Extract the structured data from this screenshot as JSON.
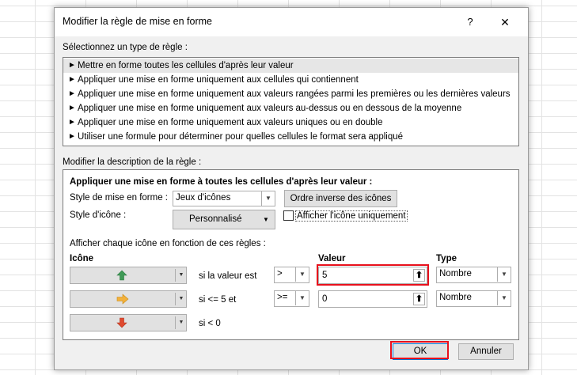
{
  "dialog": {
    "title": "Modifier la règle de mise en forme",
    "help": "?",
    "close": "✕"
  },
  "rule_type": {
    "label": "Sélectionnez un type de règle :",
    "items": [
      {
        "label": "Mettre en forme toutes les cellules d'après leur valeur",
        "selected": true
      },
      {
        "label": "Appliquer une mise en forme uniquement aux cellules qui contiennent",
        "selected": false
      },
      {
        "label": "Appliquer une mise en forme uniquement aux valeurs rangées parmi les premières ou les dernières valeurs",
        "selected": false
      },
      {
        "label": "Appliquer une mise en forme uniquement aux valeurs au-dessus ou en dessous de la moyenne",
        "selected": false
      },
      {
        "label": "Appliquer une mise en forme uniquement aux valeurs uniques ou en double",
        "selected": false
      },
      {
        "label": "Utiliser une formule pour déterminer pour quelles cellules le format sera appliqué",
        "selected": false
      }
    ]
  },
  "description": {
    "label": "Modifier la description de la règle :",
    "heading": "Appliquer une mise en forme à toutes les cellules d'après leur valeur :",
    "format_style_label": "Style de mise en forme :",
    "format_style_value": "Jeux d'icônes",
    "reverse_button": "Ordre inverse des icônes",
    "icon_style_label": "Style d'icône :",
    "icon_style_value": "Personnalisé",
    "show_icon_only_label": "Afficher l'icône uniquement",
    "show_icon_only_checked": false,
    "rules_caption": "Afficher chaque icône en fonction de ces règles :",
    "col_icon": "Icône",
    "col_value": "Valeur",
    "col_type": "Type",
    "rows": [
      {
        "icon": "green-up-arrow-icon",
        "icon_color": "#3f9a56",
        "condition": "si la valeur est",
        "operator": ">",
        "value": "5",
        "type": "Nombre"
      },
      {
        "icon": "yellow-right-arrow-icon",
        "icon_color": "#f2b13c",
        "condition": "si <= 5 et",
        "operator": ">=",
        "value": "0",
        "type": "Nombre"
      },
      {
        "icon": "red-down-arrow-icon",
        "icon_color": "#e04a2f",
        "condition": "si < 0"
      }
    ]
  },
  "buttons": {
    "ok": "OK",
    "cancel": "Annuler"
  },
  "highlight_color": "#e8101c"
}
